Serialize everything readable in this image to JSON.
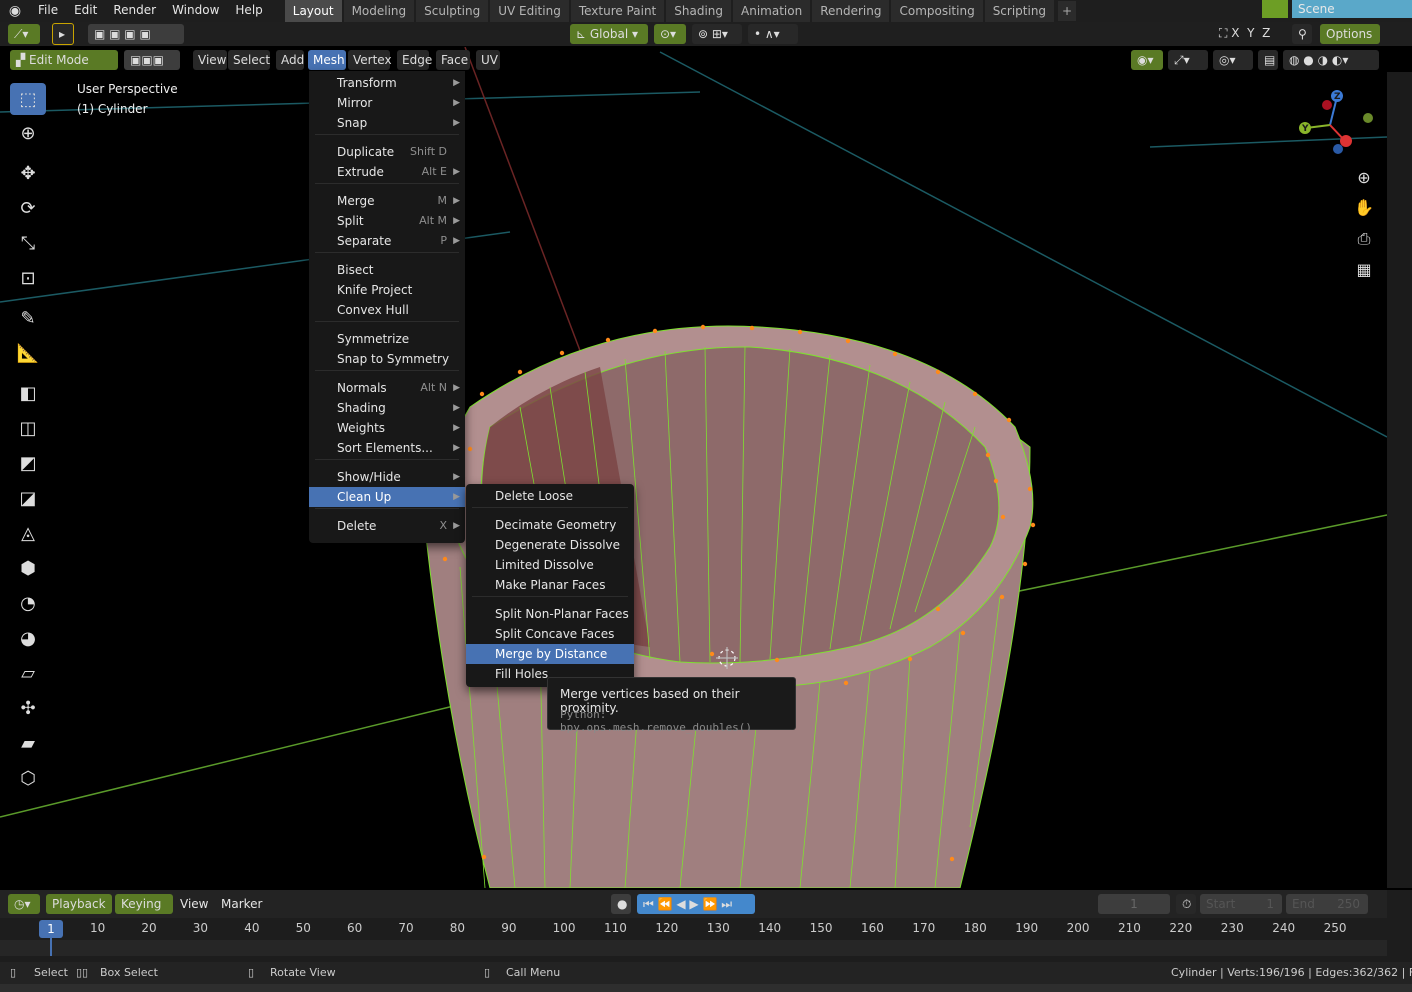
{
  "topbar": {
    "menus": [
      "File",
      "Edit",
      "Render",
      "Window",
      "Help"
    ],
    "workspaces": [
      "Layout",
      "Modeling",
      "Sculpting",
      "UV Editing",
      "Texture Paint",
      "Shading",
      "Animation",
      "Rendering",
      "Compositing",
      "Scripting"
    ],
    "active_workspace": "Layout",
    "add_tab": "+",
    "scene": "Scene"
  },
  "header": {
    "transform_orientation": "Global",
    "axes": [
      "X",
      "Y",
      "Z"
    ],
    "options": "Options"
  },
  "viewport_header": {
    "mode": "Edit Mode",
    "menus": [
      "View",
      "Select",
      "Add",
      "Mesh",
      "Vertex",
      "Edge",
      "Face",
      "UV"
    ],
    "active_menu": "Mesh"
  },
  "viewport": {
    "view_name": "User Perspective",
    "object_name": "(1) Cylinder",
    "colors": {
      "mesh_face": "#a88585",
      "mesh_edge": "#7fe030",
      "vertex": "#ff8a1a",
      "grid_cyan": "#1b5a63",
      "grid_green": "#5a9a2a",
      "axis_red": "#7a2a2a"
    }
  },
  "mesh_menu": {
    "items": [
      {
        "label": "Transform",
        "shortcut": "",
        "submenu": true
      },
      {
        "label": "Mirror",
        "shortcut": "",
        "submenu": true
      },
      {
        "label": "Snap",
        "shortcut": "",
        "submenu": true
      },
      {
        "label": "Duplicate",
        "shortcut": "Shift D",
        "submenu": false
      },
      {
        "label": "Extrude",
        "shortcut": "Alt E",
        "submenu": true
      },
      {
        "label": "Merge",
        "shortcut": "M",
        "submenu": true
      },
      {
        "label": "Split",
        "shortcut": "Alt M",
        "submenu": true
      },
      {
        "label": "Separate",
        "shortcut": "P",
        "submenu": true
      },
      {
        "label": "Bisect",
        "shortcut": "",
        "submenu": false
      },
      {
        "label": "Knife Project",
        "shortcut": "",
        "submenu": false
      },
      {
        "label": "Convex Hull",
        "shortcut": "",
        "submenu": false
      },
      {
        "label": "Symmetrize",
        "shortcut": "",
        "submenu": false
      },
      {
        "label": "Snap to Symmetry",
        "shortcut": "",
        "submenu": false
      },
      {
        "label": "Normals",
        "shortcut": "Alt N",
        "submenu": true
      },
      {
        "label": "Shading",
        "shortcut": "",
        "submenu": true
      },
      {
        "label": "Weights",
        "shortcut": "",
        "submenu": true
      },
      {
        "label": "Sort Elements...",
        "shortcut": "",
        "submenu": true
      },
      {
        "label": "Show/Hide",
        "shortcut": "",
        "submenu": true
      },
      {
        "label": "Clean Up",
        "shortcut": "",
        "submenu": true
      },
      {
        "label": "Delete",
        "shortcut": "X",
        "submenu": true
      }
    ],
    "active": "Clean Up"
  },
  "cleanup_menu": {
    "items": [
      "Delete Loose",
      "Decimate Geometry",
      "Degenerate Dissolve",
      "Limited Dissolve",
      "Make Planar Faces",
      "Split Non-Planar Faces",
      "Split Concave Faces",
      "Merge by Distance",
      "Fill Holes"
    ],
    "active": "Merge by Distance"
  },
  "tooltip": {
    "description": "Merge vertices based on their proximity.",
    "python": "Python: bpy.ops.mesh.remove_doubles()"
  },
  "timeline": {
    "playback": "Playback",
    "keying": "Keying",
    "view": "View",
    "marker": "Marker",
    "current_frame": "1",
    "start_label": "Start",
    "start": "1",
    "end_label": "End",
    "end": "250",
    "ruler": [
      "10",
      "20",
      "30",
      "40",
      "50",
      "60",
      "70",
      "80",
      "90",
      "100",
      "110",
      "120",
      "130",
      "140",
      "150",
      "160",
      "170",
      "180",
      "190",
      "200",
      "210",
      "220",
      "230",
      "240",
      "250"
    ]
  },
  "statusbar": {
    "select": "Select",
    "box_select": "Box Select",
    "rotate_view": "Rotate View",
    "call_menu": "Call Menu",
    "stats": "Cylinder | Verts:196/196 | Edges:362/362 | Faces"
  }
}
